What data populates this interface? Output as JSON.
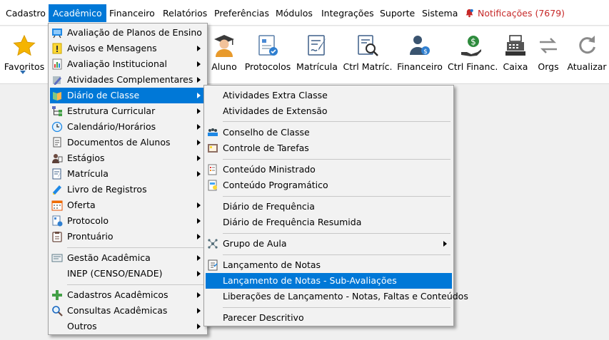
{
  "menubar": {
    "items": [
      "Cadastro",
      "Acadêmico",
      "Financeiro",
      "Relatórios",
      "Preferências",
      "Módulos",
      "Integrações",
      "Suporte",
      "Sistema"
    ],
    "notifications": "Notificações (7679)"
  },
  "toolbar": {
    "favoritos": "Favoritos",
    "aluno": "Aluno",
    "protocolos": "Protocolos",
    "matricula": "Matrícula",
    "ctrl_matric": "Ctrl Matríc.",
    "financeiro": "Financeiro",
    "ctrl_financ": "Ctrl Financ.",
    "caixa": "Caixa",
    "orgs": "Orgs",
    "atualizar": "Atualizar"
  },
  "academico_menu": {
    "items": [
      "Avaliação de Planos de Ensino",
      "Avisos e Mensagens",
      "Avaliação Institucional",
      "Atividades Complementares",
      "Diário de Classe",
      "Estrutura Curricular",
      "Calendário/Horários",
      "Documentos de Alunos",
      "Estágios",
      "Matrícula",
      "Livro de Registros",
      "Oferta",
      "Protocolo",
      "Prontuário",
      "Gestão Acadêmica",
      "INEP (CENSO/ENADE)",
      "Cadastros Acadêmicos",
      "Consultas Acadêmicas",
      "Outros"
    ]
  },
  "diario_menu": {
    "items": [
      "Atividades Extra Classe",
      "Atividades de Extensão",
      "Conselho de Classe",
      "Controle de Tarefas",
      "Conteúdo Ministrado",
      "Conteúdo Programático",
      "Diário de Frequência",
      "Diário de Frequência Resumida",
      "Grupo de Aula",
      "Lançamento de Notas",
      "Lançamento de Notas - Sub-Avaliações",
      "Liberações de Lançamento - Notas, Faltas e Conteúdos",
      "Parecer Descritivo"
    ]
  },
  "colors": {
    "accent": "#0078d7",
    "notification": "#c62828"
  }
}
